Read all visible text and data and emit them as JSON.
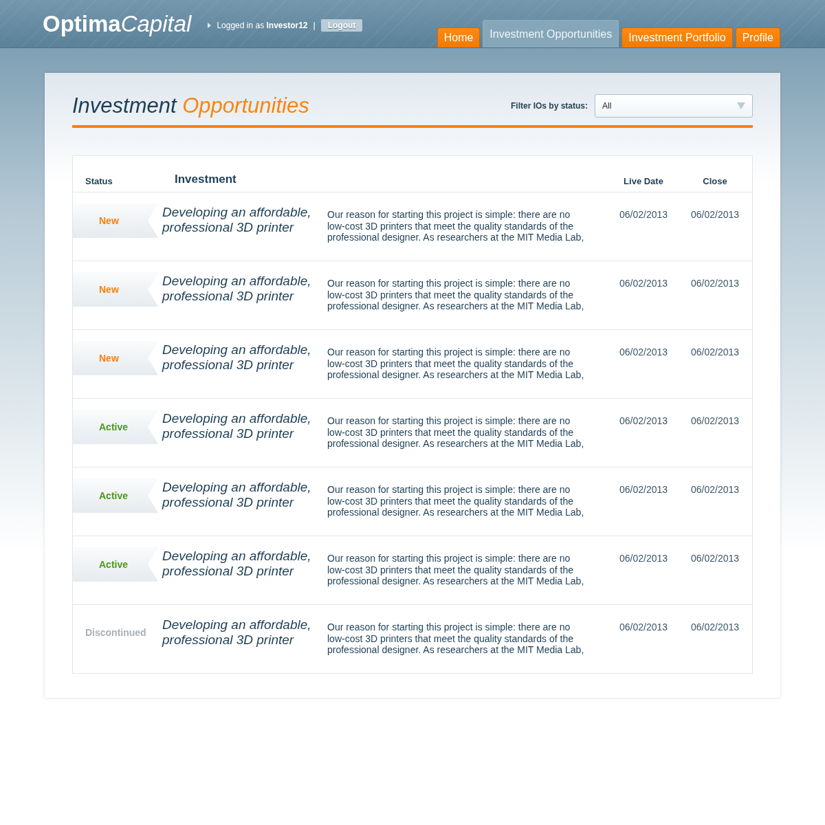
{
  "header": {
    "logo": {
      "bold": "Optima",
      "light": "Capital"
    },
    "login_text": "Logged in as **Investor12**",
    "separator": "|",
    "logout": "Logout",
    "tabs": [
      {
        "label": "Home",
        "selected": false
      },
      {
        "label": "Investment Opportunities",
        "selected": true
      },
      {
        "label": "Investment Portfolio",
        "selected": false
      },
      {
        "label": "Profile",
        "selected": false
      }
    ]
  },
  "page": {
    "title_dark": "Investment",
    "title_accent": "Opportunities",
    "filter_label": "Filter IOs by status:",
    "filter_value": "All"
  },
  "table": {
    "columns": [
      "Status",
      "Investment",
      "Live Date",
      "Close"
    ],
    "rows": [
      {
        "status": {
          "kind": "new",
          "label": "New"
        },
        "title": "Developing an affordable, professional 3D printer",
        "description": "Our reason for starting this project is simple: there are no low-cost 3D printers that meet the quality standards of the professional designer. As researchers at the MIT Media Lab,",
        "live_date": "06/02/2013",
        "close": "06/02/2013"
      },
      {
        "status": {
          "kind": "new",
          "label": "New"
        },
        "title": "Developing an affordable, professional 3D printer",
        "description": "Our reason for starting this project is simple: there are no low-cost 3D printers that meet the quality standards of the professional designer. As researchers at the MIT Media Lab,",
        "live_date": "06/02/2013",
        "close": "06/02/2013"
      },
      {
        "status": {
          "kind": "new",
          "label": "New"
        },
        "title": "Developing an affordable, professional 3D printer",
        "description": "Our reason for starting this project is simple: there are no low-cost 3D printers that meet the quality standards of the professional designer. As researchers at the MIT Media Lab,",
        "live_date": "06/02/2013",
        "close": "06/02/2013"
      },
      {
        "status": {
          "kind": "active",
          "label": "Active"
        },
        "title": "Developing an affordable, professional 3D printer",
        "description": "Our reason for starting this project is simple: there are no low-cost 3D printers that meet the quality standards of the professional designer. As researchers at the MIT Media Lab,",
        "live_date": "06/02/2013",
        "close": "06/02/2013"
      },
      {
        "status": {
          "kind": "active",
          "label": "Active"
        },
        "title": "Developing an affordable, professional 3D printer",
        "description": "Our reason for starting this project is simple: there are no low-cost 3D printers that meet the quality standards of the professional designer. As researchers at the MIT Media Lab,",
        "live_date": "06/02/2013",
        "close": "06/02/2013"
      },
      {
        "status": {
          "kind": "active",
          "label": "Active"
        },
        "title": "Developing an affordable, professional 3D printer",
        "description": "Our reason for starting this project is simple: there are no low-cost 3D printers that meet the quality standards of the professional designer. As researchers at the MIT Media Lab,",
        "live_date": "06/02/2013",
        "close": "06/02/2013"
      },
      {
        "status": {
          "kind": "discontinued",
          "label": "Discontinued"
        },
        "title": "Developing an affordable, professional 3D printer",
        "description": "Our reason for starting this project is simple: there are no low-cost 3D printers that meet the quality standards of the professional designer. As researchers at the MIT Media Lab,",
        "live_date": "06/02/2013",
        "close": "06/02/2013"
      }
    ]
  }
}
